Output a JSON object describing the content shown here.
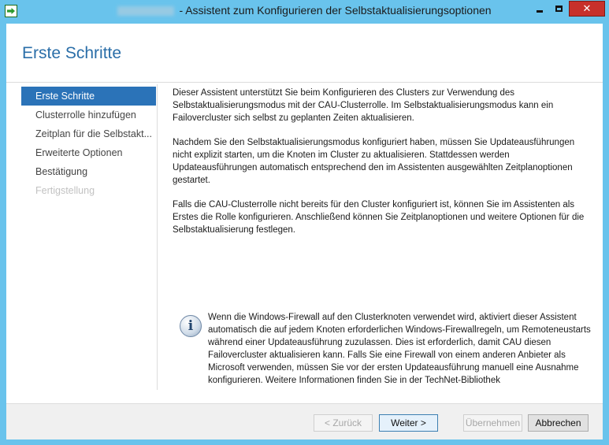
{
  "window": {
    "title": "- Assistent zum Konfigurieren der Selbstaktualisierungsoptionen",
    "icon": "green-arrow-app-icon",
    "controls": {
      "minimize": "minimize-icon",
      "maximize": "maximize-icon",
      "close": "✕"
    }
  },
  "page": {
    "title": "Erste Schritte"
  },
  "nav": {
    "items": [
      {
        "label": "Erste Schritte",
        "state": "active"
      },
      {
        "label": "Clusterrolle hinzufügen",
        "state": "normal"
      },
      {
        "label": "Zeitplan für die Selbstakt...",
        "state": "normal"
      },
      {
        "label": "Erweiterte Optionen",
        "state": "normal"
      },
      {
        "label": "Bestätigung",
        "state": "normal"
      },
      {
        "label": "Fertigstellung",
        "state": "disabled"
      }
    ]
  },
  "content": {
    "paragraphs": [
      "Dieser Assistent unterstützt Sie beim Konfigurieren des Clusters zur Verwendung des Selbstaktualisierungsmodus mit der CAU-Clusterrolle. Im Selbstaktualisierungsmodus kann ein Failovercluster sich selbst zu geplanten Zeiten aktualisieren.",
      "Nachdem Sie den Selbstaktualisierungsmodus konfiguriert haben, müssen Sie Updateausführungen nicht explizit starten, um die Knoten im Cluster zu aktualisieren. Stattdessen werden Updateausführungen automatisch entsprechend den im Assistenten ausgewählten Zeitplanoptionen gestartet.",
      "Falls die CAU-Clusterrolle nicht bereits für den Cluster konfiguriert ist, können Sie im Assistenten als Erstes die Rolle konfigurieren. Anschließend können Sie Zeitplanoptionen und weitere Optionen für die Selbstaktualisierung festlegen."
    ]
  },
  "info": {
    "icon": "info-icon",
    "text": "Wenn die Windows-Firewall auf den Clusterknoten verwendet wird, aktiviert dieser Assistent automatisch die auf jedem Knoten erforderlichen Windows-Firewallregeln, um Remoteneustarts während einer Updateausführung zuzulassen. Dies ist erforderlich, damit CAU diesen Failovercluster aktualisieren kann. Falls Sie eine Firewall von einem anderen Anbieter als Microsoft verwenden, müssen Sie vor der ersten Updateausführung manuell eine Ausnahme konfigurieren. Weitere Informationen finden Sie in der TechNet-Bibliothek"
  },
  "buttons": {
    "back": "< Zurück",
    "next": "Weiter >",
    "apply": "Übernehmen",
    "cancel": "Abbrechen"
  },
  "colors": {
    "titlebar": "#69c3ec",
    "accent": "#2b73b8",
    "heading": "#2a6ea8",
    "close": "#c7302b"
  }
}
